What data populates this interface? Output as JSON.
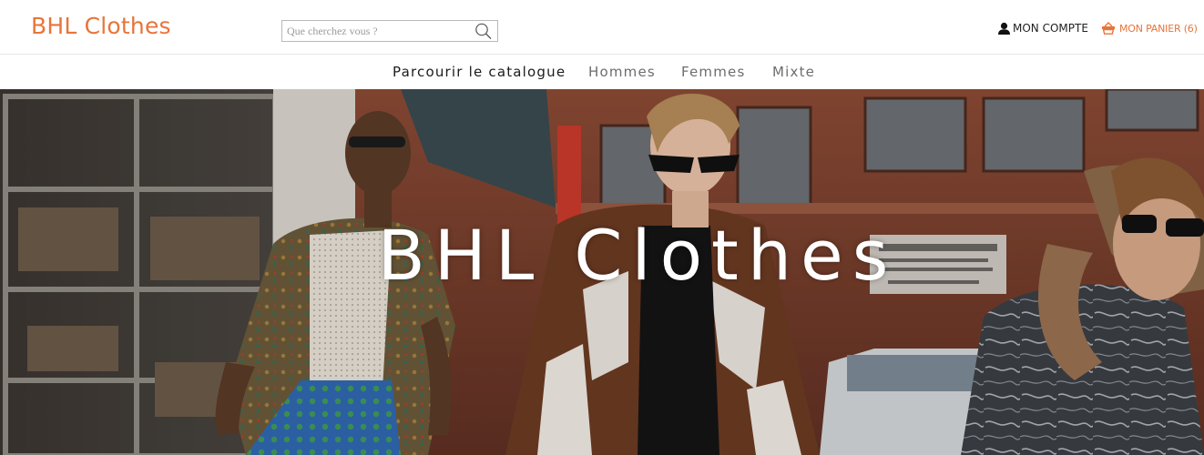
{
  "header": {
    "brand": "BHL Clothes",
    "search": {
      "placeholder": "Que cherchez vous ?"
    },
    "account_label": "MON COMPTE",
    "cart_label": "MON PANIER (6)"
  },
  "nav": {
    "items": [
      {
        "label": "Parcourir le catalogue"
      },
      {
        "label": "Hommes"
      },
      {
        "label": "Femmes"
      },
      {
        "label": "Mixte"
      }
    ]
  },
  "hero": {
    "title": "BHL Clothes"
  },
  "colors": {
    "brand": "#e8743b",
    "text": "#222222",
    "nav_muted": "#6d6d6d"
  },
  "icons": [
    "search-icon",
    "user-icon",
    "basket-icon"
  ]
}
